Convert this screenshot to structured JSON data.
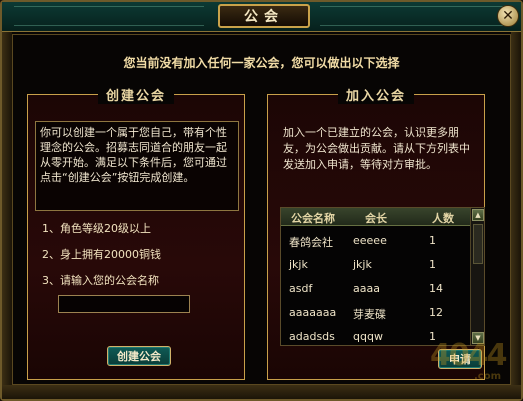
{
  "window": {
    "title": "公会",
    "close_icon": "close-icon"
  },
  "notice": "您当前没有加入任何一家公会，您可以做出以下选择",
  "create_panel": {
    "heading": "创建公会",
    "description": "你可以创建一个属于您自己，带有个性理念的公会。招募志同道合的朋友一起从零开始。满足以下条件后，您可通过点击“创建公会”按钮完成创建。",
    "requirements": [
      "1、角色等级20级以上",
      "2、身上拥有20000铜钱",
      "3、请输入您的公会名称"
    ],
    "name_input_value": "",
    "create_button": "创建公会"
  },
  "join_panel": {
    "heading": "加入公会",
    "description": "加入一个已建立的公会，认识更多朋友，为公会做出贡献。请从下方列表中发送加入申请，等待对方审批。",
    "columns": [
      "公会名称",
      "会长",
      "人数"
    ],
    "rows": [
      {
        "name": "春鸽会社",
        "leader": "eeeee",
        "count": "1"
      },
      {
        "name": "jkjk",
        "leader": "jkjk",
        "count": "1"
      },
      {
        "name": "asdf",
        "leader": "aaaa",
        "count": "14"
      },
      {
        "name": "aaaaaaa",
        "leader": "芽麦碟",
        "count": "12"
      },
      {
        "name": "adadsds",
        "leader": "qqqw",
        "count": "1"
      }
    ],
    "apply_button": "申请"
  },
  "watermark": {
    "big": "4044",
    "com": ".com"
  }
}
